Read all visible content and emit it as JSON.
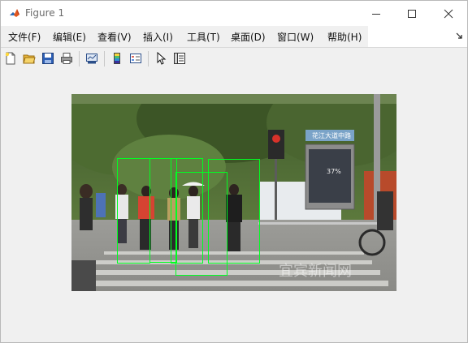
{
  "window": {
    "title": "Figure 1"
  },
  "menu": {
    "items": [
      {
        "label": "文件(F)"
      },
      {
        "label": "编辑(E)"
      },
      {
        "label": "查看(V)"
      },
      {
        "label": "插入(I)"
      },
      {
        "label": "工具(T)"
      },
      {
        "label": "桌面(D)"
      },
      {
        "label": "窗口(W)"
      },
      {
        "label": "帮助(H)"
      }
    ],
    "overflow_icon": "dock-arrow-icon"
  },
  "toolbar": {
    "icons": [
      "new-figure-icon",
      "open-file-icon",
      "save-icon",
      "print-icon",
      "link-plot-icon",
      "insert-colorbar-icon",
      "insert-legend-icon",
      "edit-plot-pointer-icon",
      "property-inspector-icon"
    ]
  },
  "image": {
    "signage": {
      "street_sign": "花江大道中路",
      "billboard_text": "37%",
      "watermark": "宜宾新闻网"
    },
    "detections_count": 5,
    "box_color": "#00ff22"
  },
  "colors": {
    "titlebar": "#ffffff",
    "background": "#f0f0f0",
    "detection_box": "#00ff22"
  }
}
